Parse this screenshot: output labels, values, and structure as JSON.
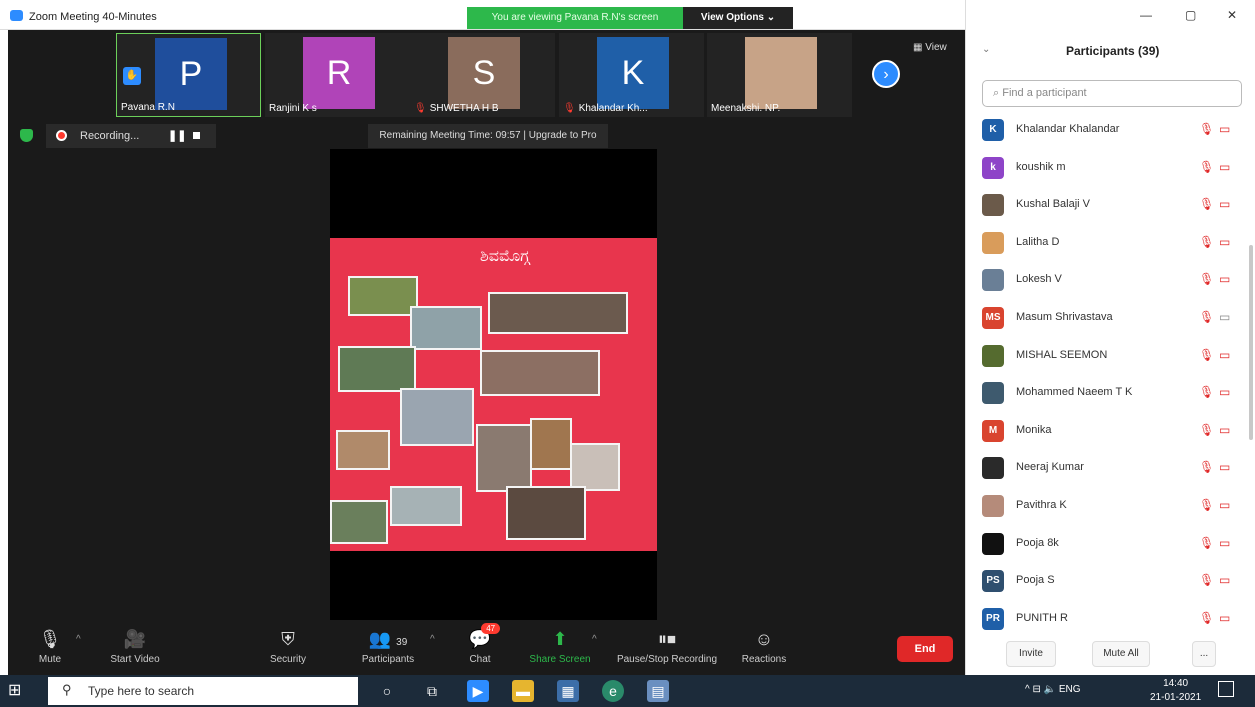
{
  "window": {
    "title": "Zoom Meeting 40-Minutes",
    "viewing_banner": "You are viewing Pavana R.N's screen",
    "view_options": "View Options ⌄"
  },
  "thumbnails": [
    {
      "initial": "P",
      "name": "Pavana R.N",
      "color": "#1f4e9c",
      "muted": false
    },
    {
      "initial": "R",
      "name": "Ranjini K s",
      "color": "#b044b8",
      "muted": false
    },
    {
      "initial": "S",
      "name": "SHWETHA H B",
      "color": "#8a6c5c",
      "muted": true
    },
    {
      "initial": "K",
      "name": "Khalandar Kh...",
      "color": "#1f5fa8",
      "muted": true
    },
    {
      "initial": "",
      "name": "Meenakshi. NP.",
      "color": "#c7a387",
      "muted": false
    }
  ],
  "view_button": "View",
  "recording": {
    "label": "Recording..."
  },
  "remaining_time": "Remaining Meeting Time: 09:57 | Upgrade to Pro",
  "poster": {
    "heading": "ಶಿವಮೊಗ್ಗ"
  },
  "toolbar": {
    "mute": "Mute",
    "start_video": "Start Video",
    "security": "Security",
    "participants": "Participants",
    "participants_count": "39",
    "chat": "Chat",
    "chat_badge": "47",
    "share_screen": "Share Screen",
    "pause_stop_recording": "Pause/Stop Recording",
    "reactions": "Reactions",
    "end": "End"
  },
  "panel": {
    "title": "Participants (39)",
    "search_placeholder": "Find a participant",
    "invite": "Invite",
    "mute_all": "Mute All",
    "more": "..."
  },
  "participants": [
    {
      "initials": "K",
      "name": "Khalandar Khalandar",
      "color": "#1f5fa8",
      "video_on": false
    },
    {
      "initials": "k",
      "name": "koushik m",
      "color": "#8e44c8",
      "video_on": false
    },
    {
      "initials": "",
      "name": "Kushal Balaji V",
      "color": "#6b5a4a",
      "video_on": false
    },
    {
      "initials": "",
      "name": "Lalitha D",
      "color": "#d99c5b",
      "video_on": false
    },
    {
      "initials": "",
      "name": "Lokesh V",
      "color": "#6a7f96",
      "video_on": false
    },
    {
      "initials": "MS",
      "name": "Masum Shrivastava",
      "color": "#d9442f",
      "video_on": true
    },
    {
      "initials": "",
      "name": "MISHAL SEEMON",
      "color": "#556b2f",
      "video_on": false
    },
    {
      "initials": "",
      "name": "Mohammed Naeem T K",
      "color": "#3e5a6e",
      "video_on": false
    },
    {
      "initials": "M",
      "name": "Monika",
      "color": "#d9442f",
      "video_on": false
    },
    {
      "initials": "",
      "name": "Neeraj Kumar",
      "color": "#2a2a2a",
      "video_on": false
    },
    {
      "initials": "",
      "name": "Pavithra K",
      "color": "#b58b7a",
      "video_on": false
    },
    {
      "initials": "",
      "name": "Pooja 8k",
      "color": "#111111",
      "video_on": false
    },
    {
      "initials": "PS",
      "name": "Pooja S",
      "color": "#2f4f6f",
      "video_on": false
    },
    {
      "initials": "PR",
      "name": "PUNITH R",
      "color": "#1f5fa8",
      "video_on": false
    }
  ],
  "taskbar": {
    "search_placeholder": "Type here to search",
    "language": "ENG",
    "time": "14:40",
    "date": "21-01-2021"
  }
}
